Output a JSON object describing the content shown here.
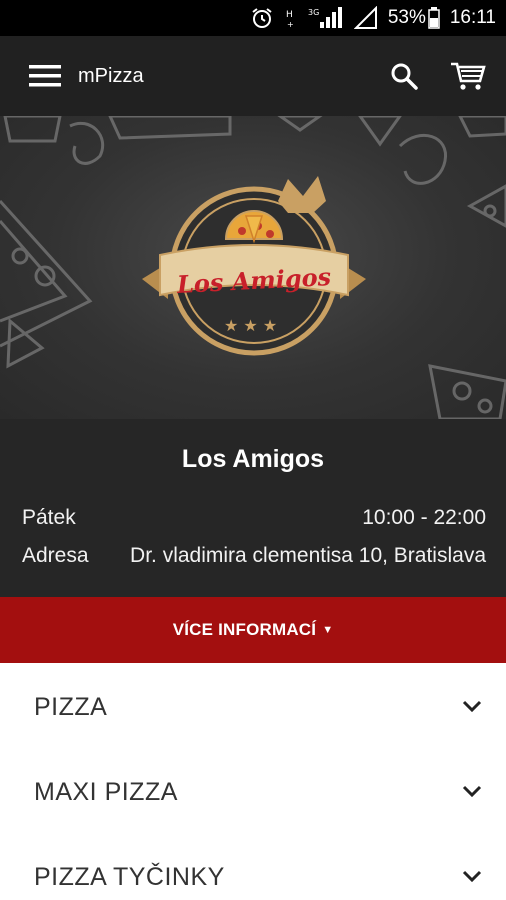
{
  "status_bar": {
    "battery": "53%",
    "time": "16:11",
    "network": "3G",
    "icons": [
      "alarm-icon",
      "hplus-signal-icon",
      "signal-icon",
      "wifi-icon",
      "battery-icon"
    ]
  },
  "app_bar": {
    "title": "mPizza",
    "icons": [
      "menu-icon",
      "search-icon",
      "cart-icon"
    ]
  },
  "hero": {
    "logo_text": "Los Amigos"
  },
  "restaurant": {
    "name": "Los Amigos",
    "day_label": "Pátek",
    "hours": "10:00 - 22:00",
    "address_label": "Adresa",
    "address": "Dr. vladimira clementisa 10, Bratislava"
  },
  "more_info": {
    "label": "VÍCE INFORMACÍ",
    "caret": "▼"
  },
  "categories": [
    {
      "label": "PIZZA"
    },
    {
      "label": "MAXI PIZZA"
    },
    {
      "label": "PIZZA TYČINKY"
    }
  ],
  "colors": {
    "app_bar": "#212121",
    "info_panel": "#262626",
    "accent_red": "#a30f0f",
    "logo_gold": "#c9a063"
  }
}
